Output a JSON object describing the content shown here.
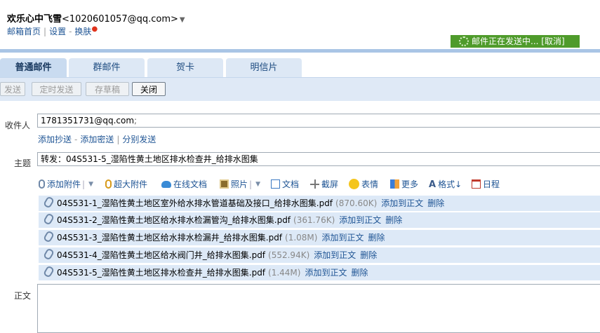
{
  "header": {
    "user_name": "欢乐心中飞雪",
    "user_email": "<1020601057@qq.com>",
    "caret": "▼",
    "link_home": "邮箱首页",
    "link_settings": "设置",
    "link_skin": "换肤",
    "status_text": "邮件正在发送中... [取消]"
  },
  "tabs": [
    "普通邮件",
    "群邮件",
    "贺卡",
    "明信片"
  ],
  "toolbar": {
    "send": "发送",
    "scheduled": "定时发送",
    "draft": "存草稿",
    "close": "关闭"
  },
  "form": {
    "to_label": "收件人",
    "to_value": "1781351731@qq.com",
    "to_semicolon": ";",
    "add_cc": "添加抄送",
    "add_bcc": "添加密送",
    "separate_send": "分别发送",
    "subject_label": "主题",
    "subject_value": "转发：04S531-5_湿陷性黄土地区排水检查井_给排水图集",
    "body_label": "正文"
  },
  "attach_toolbar": {
    "add_attachment": "添加附件",
    "large_attachment": "超大附件",
    "online_doc": "在线文档",
    "photo": "照片",
    "document": "文档",
    "screenshot": "截屏",
    "emoji": "表情",
    "more": "更多",
    "format": "格式",
    "format_arrow": "↓",
    "calendar": "日程"
  },
  "attachments": [
    {
      "name": "04S531-1_湿陷性黄土地区室外给水排水管道基础及接口_给排水图集.pdf",
      "size": "(870.60K)",
      "add": "添加到正文",
      "del": "删除"
    },
    {
      "name": "04S531-2_湿陷性黄土地区给水排水检漏管沟_给排水图集.pdf",
      "size": "(361.76K)",
      "add": "添加到正文",
      "del": "删除"
    },
    {
      "name": "04S531-3_湿陷性黄土地区给水排水检漏井_给排水图集.pdf",
      "size": "(1.08M)",
      "add": "添加到正文",
      "del": "删除"
    },
    {
      "name": "04S531-4_湿陷性黄土地区给水阀门井_给排水图集.pdf",
      "size": "(552.94K)",
      "add": "添加到正文",
      "del": "删除"
    },
    {
      "name": "04S531-5_湿陷性黄土地区排水检查井_给排水图集.pdf",
      "size": "(1.44M)",
      "add": "添加到正文",
      "del": "删除"
    }
  ],
  "colors": {
    "status_bg": "#4f9b2b",
    "link": "#1e5494",
    "tab_active": "#c9dbf0"
  }
}
